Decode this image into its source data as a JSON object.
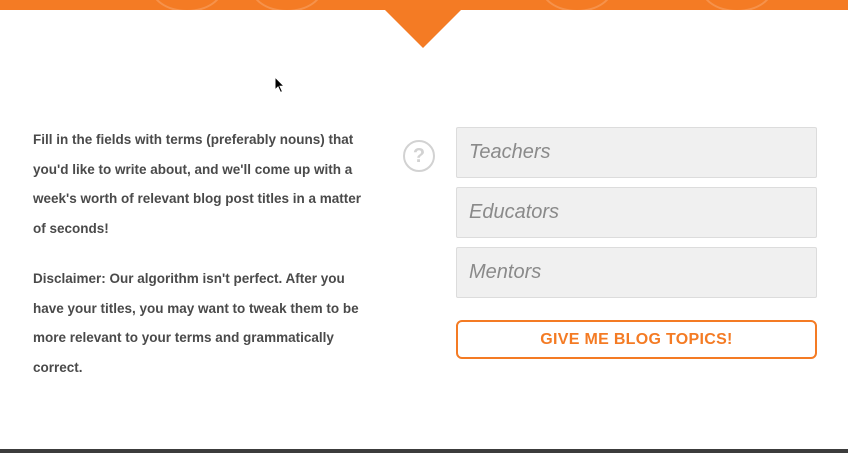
{
  "colors": {
    "accent": "#f47b24",
    "text": "#4a4a4a",
    "field_bg": "#f0f0f0"
  },
  "intro_text": "Fill in the fields with terms (preferably nouns) that you'd like to write about, and we'll come up with a week's worth of relevant blog post titles in a matter of seconds!",
  "disclaimer_text": "Disclaimer: Our algorithm isn't perfect. After you have your titles, you may want to tweak them to be more relevant to your terms and grammatically correct.",
  "help_icon": {
    "icon": "question-circle-icon",
    "glyph": "?"
  },
  "fields": [
    {
      "placeholder": "Teachers",
      "value": ""
    },
    {
      "placeholder": "Educators",
      "value": ""
    },
    {
      "placeholder": "Mentors",
      "value": ""
    }
  ],
  "submit_label": "GIVE ME BLOG TOPICS!"
}
